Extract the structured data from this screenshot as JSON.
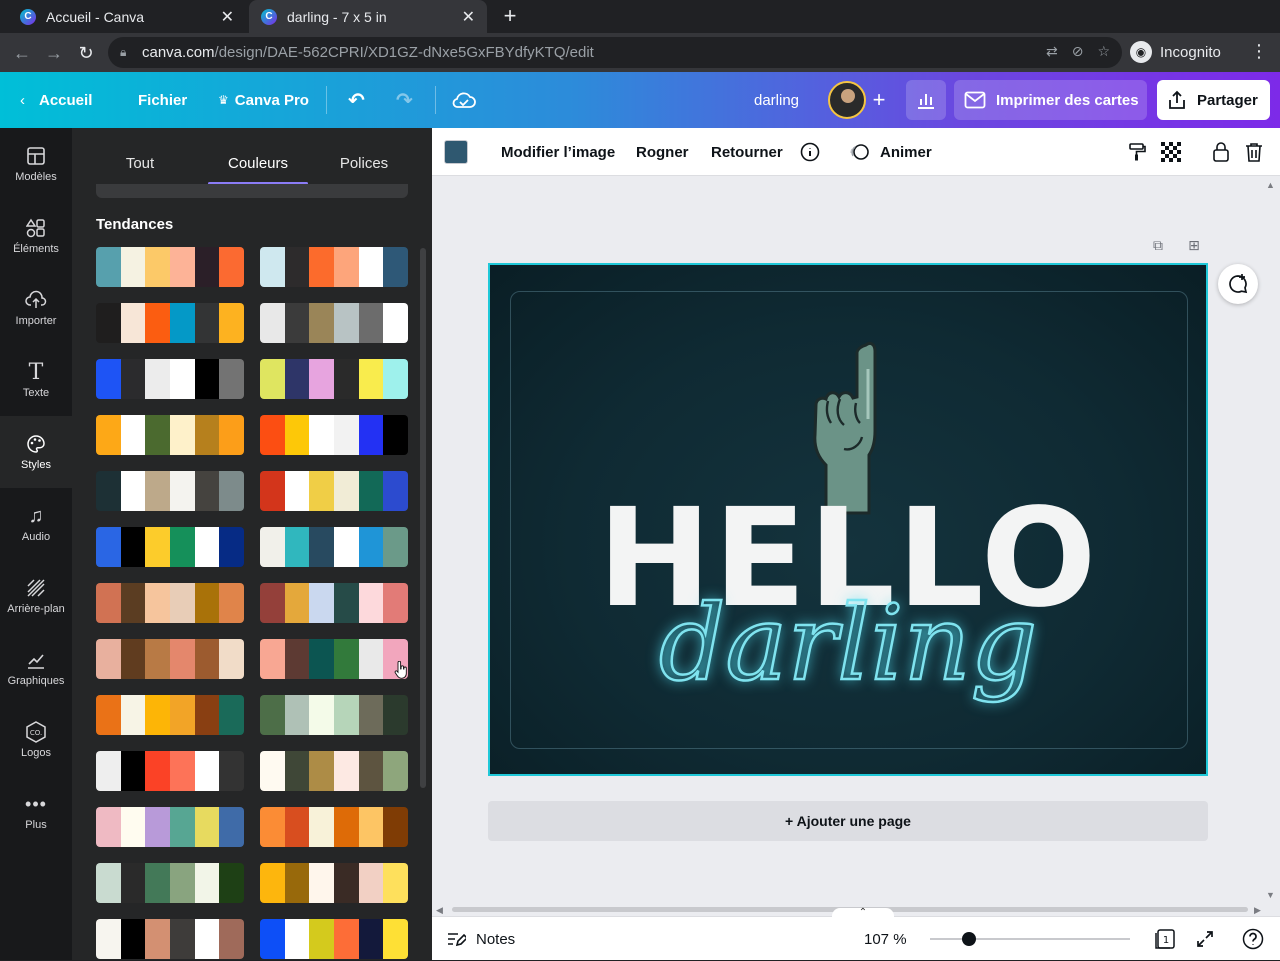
{
  "browser": {
    "tabs": [
      {
        "title": "Accueil - Canva"
      },
      {
        "title": "darling - 7 x 5 in"
      }
    ],
    "url_host": "canva.com",
    "url_path": "/design/DAE-562CPRI/XD1GZ-dNxe5GxFBYdfyKTQ/edit",
    "incognito_label": "Incognito"
  },
  "topbar": {
    "home_label": "Accueil",
    "file_label": "Fichier",
    "pro_label": "Canva Pro",
    "design_name": "darling",
    "print_label": "Imprimer des cartes",
    "share_label": "Partager"
  },
  "rail": {
    "items": [
      {
        "label": "Modèles",
        "icon": "templates-icon"
      },
      {
        "label": "Éléments",
        "icon": "elements-icon"
      },
      {
        "label": "Importer",
        "icon": "upload-icon"
      },
      {
        "label": "Texte",
        "icon": "text-icon"
      },
      {
        "label": "Styles",
        "icon": "palette-icon"
      },
      {
        "label": "Audio",
        "icon": "music-icon"
      },
      {
        "label": "Arrière-plan",
        "icon": "background-icon"
      },
      {
        "label": "Graphiques",
        "icon": "chart-icon"
      },
      {
        "label": "Logos",
        "icon": "logo-icon"
      },
      {
        "label": "Plus",
        "icon": "more-icon"
      }
    ]
  },
  "panel": {
    "tabs": [
      {
        "label": "Tout"
      },
      {
        "label": "Couleurs"
      },
      {
        "label": "Polices"
      }
    ],
    "section_title": "Tendances",
    "palettes": [
      [
        "#57a0ad",
        "#f5f2e2",
        "#fcc968",
        "#fdb397",
        "#2b1f28",
        "#fb6a31"
      ],
      [
        "#cfe8ef",
        "#2d2b2c",
        "#fc6b2c",
        "#fda57b",
        "#ffffff",
        "#2e5877"
      ],
      [
        "#1f1e1e",
        "#f7e6d7",
        "#fb5d11",
        "#0499c7",
        "#333435",
        "#fdb220"
      ],
      [
        "#e8e8e8",
        "#3b3b3b",
        "#9a8558",
        "#b8c3c4",
        "#6c6c6c",
        "#ffffff"
      ],
      [
        "#1e54f5",
        "#2b2b2d",
        "#ececec",
        "#ffffff",
        "#000000",
        "#737373"
      ],
      [
        "#dfe560",
        "#2e3568",
        "#e7a4df",
        "#2a2a2a",
        "#f9ec4d",
        "#9ef1ec"
      ],
      [
        "#fda817",
        "#ffffff",
        "#4b6a2f",
        "#fef1ca",
        "#b6801d",
        "#fc9e19"
      ],
      [
        "#fc4e12",
        "#fdc808",
        "#ffffff",
        "#f2f2f2",
        "#2331f3",
        "#000000"
      ],
      [
        "#1d3035",
        "#ffffff",
        "#bda98a",
        "#f4f3ef",
        "#45433f",
        "#7d8b8b"
      ],
      [
        "#d3351b",
        "#ffffff",
        "#f0ce46",
        "#f1ecd6",
        "#126957",
        "#2c4bcf"
      ],
      [
        "#2a66e4",
        "#000000",
        "#fccc2b",
        "#15905a",
        "#ffffff",
        "#062b85"
      ],
      [
        "#f1f0ea",
        "#30b7be",
        "#284a60",
        "#ffffff",
        "#1f95d7",
        "#6b9a89"
      ],
      [
        "#d17253",
        "#5b3d22",
        "#f6c59d",
        "#e8cdb7",
        "#a97209",
        "#e0844a"
      ],
      [
        "#94403a",
        "#e4a83b",
        "#cad8ef",
        "#264b48",
        "#fdd9dc",
        "#e27b77"
      ],
      [
        "#e8b09e",
        "#603c1f",
        "#b87a45",
        "#e4876c",
        "#9c5b2f",
        "#f1dcc8"
      ],
      [
        "#f8a793",
        "#5d3a33",
        "#0c5551",
        "#327a3b",
        "#e9e9e9",
        "#f2a6bd"
      ],
      [
        "#ea7217",
        "#f7f4e6",
        "#fdb506",
        "#f2a427",
        "#893f12",
        "#1a6a59"
      ],
      [
        "#4d6e48",
        "#afc1b6",
        "#f4fbe9",
        "#b6d5b9",
        "#6d6b5a",
        "#2b3a2d"
      ],
      [
        "#eeeeee",
        "#000000",
        "#fb4226",
        "#fd7358",
        "#ffffff",
        "#333333"
      ],
      [
        "#fffaf1",
        "#3f4737",
        "#ad8c46",
        "#fde9e3",
        "#5d5440",
        "#8ea67c"
      ],
      [
        "#efbac3",
        "#fffcf0",
        "#b89ad9",
        "#57a693",
        "#e7da5f",
        "#3f6ba8"
      ],
      [
        "#fb8c35",
        "#d84e1f",
        "#f8f2d9",
        "#de6b07",
        "#fdc564",
        "#7f3c05"
      ],
      [
        "#c9dbd0",
        "#2a2a2a",
        "#437958",
        "#89a47f",
        "#f2f5e8",
        "#1e4015"
      ],
      [
        "#fdb60d",
        "#98690b",
        "#fff6ec",
        "#3a2b25",
        "#f2d0c4",
        "#fee05c"
      ],
      [
        "#f7f5ef",
        "#000000",
        "#d39072",
        "#3e3c3a",
        "#ffffff",
        "#9f6a5a"
      ],
      [
        "#0d4ff7",
        "#ffffff",
        "#d4ca1d",
        "#fd6d37",
        "#13193b",
        "#fee035"
      ]
    ]
  },
  "context_toolbar": {
    "edit_image": "Modifier l’image",
    "crop": "Rogner",
    "flip": "Retourner",
    "animate": "Animer"
  },
  "canvas": {
    "headline": "HELLO",
    "script_text": "darling",
    "bg_color": "#0f2a33",
    "text_glow_color": "#7fe3ef"
  },
  "add_page_label": "+ Ajouter une page",
  "bottombar": {
    "notes_label": "Notes",
    "zoom": "107 %",
    "page_count": "1"
  }
}
